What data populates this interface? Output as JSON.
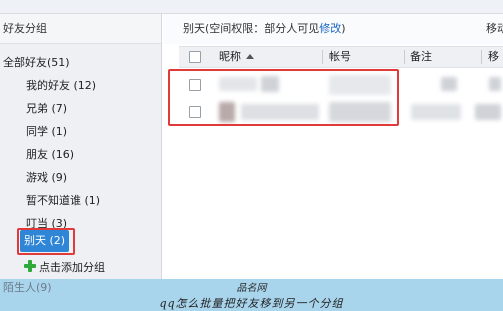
{
  "sidebar": {
    "header": "好友分组",
    "groups": [
      {
        "label": "全部好友(51)"
      },
      {
        "label": "我的好友 (12)"
      },
      {
        "label": "兄弟 (7)"
      },
      {
        "label": "同学 (1)"
      },
      {
        "label": "朋友 (16)"
      },
      {
        "label": "游戏 (9)"
      },
      {
        "label": "暂不知道谁 (1)"
      },
      {
        "label": "叮当 (3)"
      },
      {
        "label": "别天 (2)"
      }
    ],
    "add_group": "点击添加分组",
    "stranger": "陌生人(9)"
  },
  "main": {
    "info_prefix": "别天(空间权限：部分人可见",
    "info_link": "修改",
    "info_suffix": ")",
    "move_label": "移动",
    "columns": {
      "nickname": "昵称",
      "account": "帐号",
      "remark": "备注",
      "extra": "移"
    }
  },
  "watermark": {
    "site": "品名网",
    "caption": "qq怎么批量把好友移到另一个分组"
  },
  "colors": {
    "selected": "#2f86d6",
    "highlight_outline": "#e03a3a",
    "link": "#1a66c2",
    "watermark_band": "#a8d4ec"
  }
}
